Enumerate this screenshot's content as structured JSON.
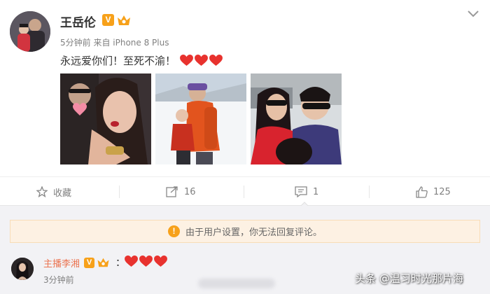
{
  "post": {
    "username": "王岳伦",
    "verified_badge": "V",
    "meta": "5分钟前 来自 iPhone 8 Plus",
    "text": "永远爱你们！至死不渝！",
    "hearts": 3,
    "photos": [
      "photo-1",
      "photo-2",
      "photo-3"
    ]
  },
  "actions": {
    "favorite_label": "收藏",
    "repost_count": "16",
    "comment_count": "1",
    "like_count": "125"
  },
  "notice": {
    "text": "由于用户设置，你无法回复评论。",
    "icon": "!"
  },
  "comment": {
    "username": "主播李湘",
    "verified_badge": "V",
    "colon": "：",
    "time": "3分钟前"
  },
  "watermark": "头条 @温习时光那片海",
  "colors": {
    "accent_orange": "#f7a11a",
    "heart_red": "#e8322e",
    "comment_name": "#eb7350",
    "notice_bg": "#fdf1e3"
  }
}
